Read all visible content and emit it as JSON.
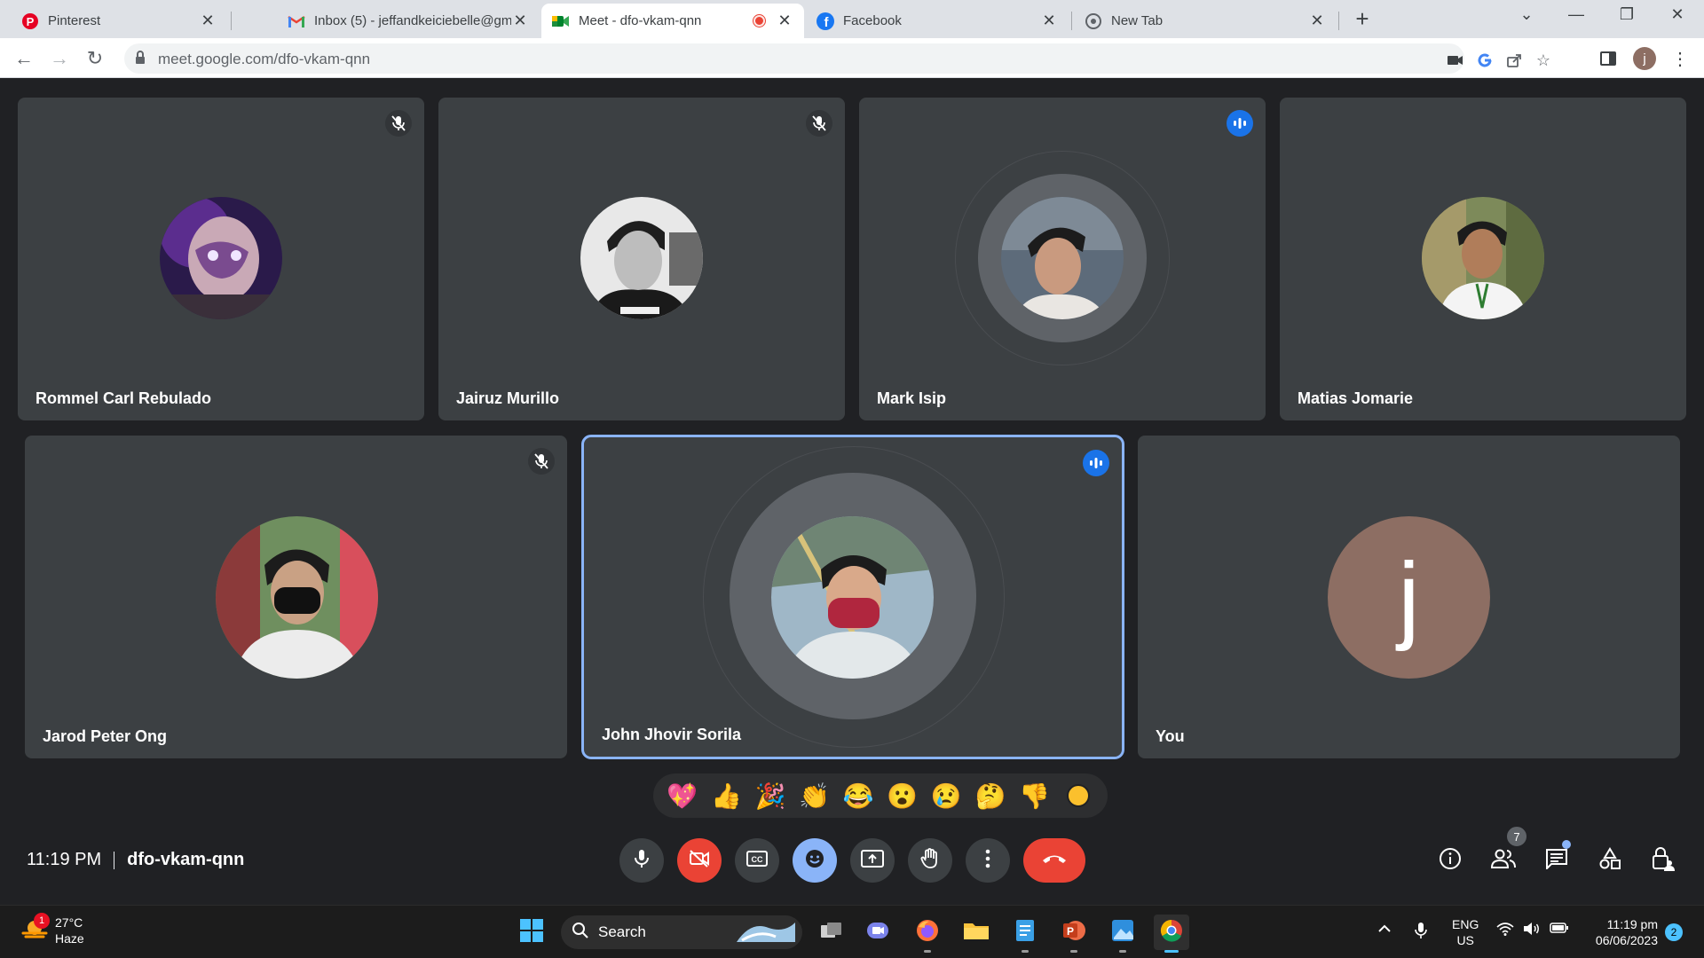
{
  "browser": {
    "tabs": [
      {
        "title": "Pinterest",
        "icon": "pinterest-icon"
      },
      {
        "title": "Inbox (5) - jeffandkeiciebelle@gm",
        "icon": "gmail-icon"
      },
      {
        "title": "Meet - dfo-vkam-qnn",
        "icon": "meet-icon",
        "active": true,
        "recording": true
      },
      {
        "title": "Facebook",
        "icon": "facebook-icon"
      },
      {
        "title": "New Tab",
        "icon": "chrome-icon"
      }
    ],
    "url_host": "meet.google.com",
    "url_path": "/dfo-vkam-qnn",
    "profile_initial": "j"
  },
  "meet": {
    "participants": [
      {
        "name": "Rommel Carl Rebulado",
        "state": "muted"
      },
      {
        "name": "Jairuz Murillo",
        "state": "muted"
      },
      {
        "name": "Mark Isip",
        "state": "speaking"
      },
      {
        "name": "Matias Jomarie",
        "state": "none"
      },
      {
        "name": "Jarod Peter Ong",
        "state": "muted"
      },
      {
        "name": "John Jhovir Sorila",
        "state": "speaking",
        "highlighted": true
      },
      {
        "name": "You",
        "state": "none",
        "initial": "j"
      }
    ],
    "reactions": [
      "💖",
      "👍",
      "🎉",
      "👏",
      "😂",
      "😮",
      "😢",
      "🤔",
      "👎"
    ],
    "time": "11:19 PM",
    "meeting_code": "dfo-vkam-qnn",
    "people_count": "7",
    "colors": {
      "accent": "#8ab4f8",
      "danger": "#ea4335",
      "tile": "#3c4043",
      "background": "#202124"
    }
  },
  "taskbar": {
    "weather_temp": "27°C",
    "weather_desc": "Haze",
    "weather_badge": "1",
    "search_label": "Search",
    "lang_top": "ENG",
    "lang_bottom": "US",
    "clock_time": "11:19 pm",
    "clock_date": "06/06/2023",
    "notification_count": "2"
  }
}
